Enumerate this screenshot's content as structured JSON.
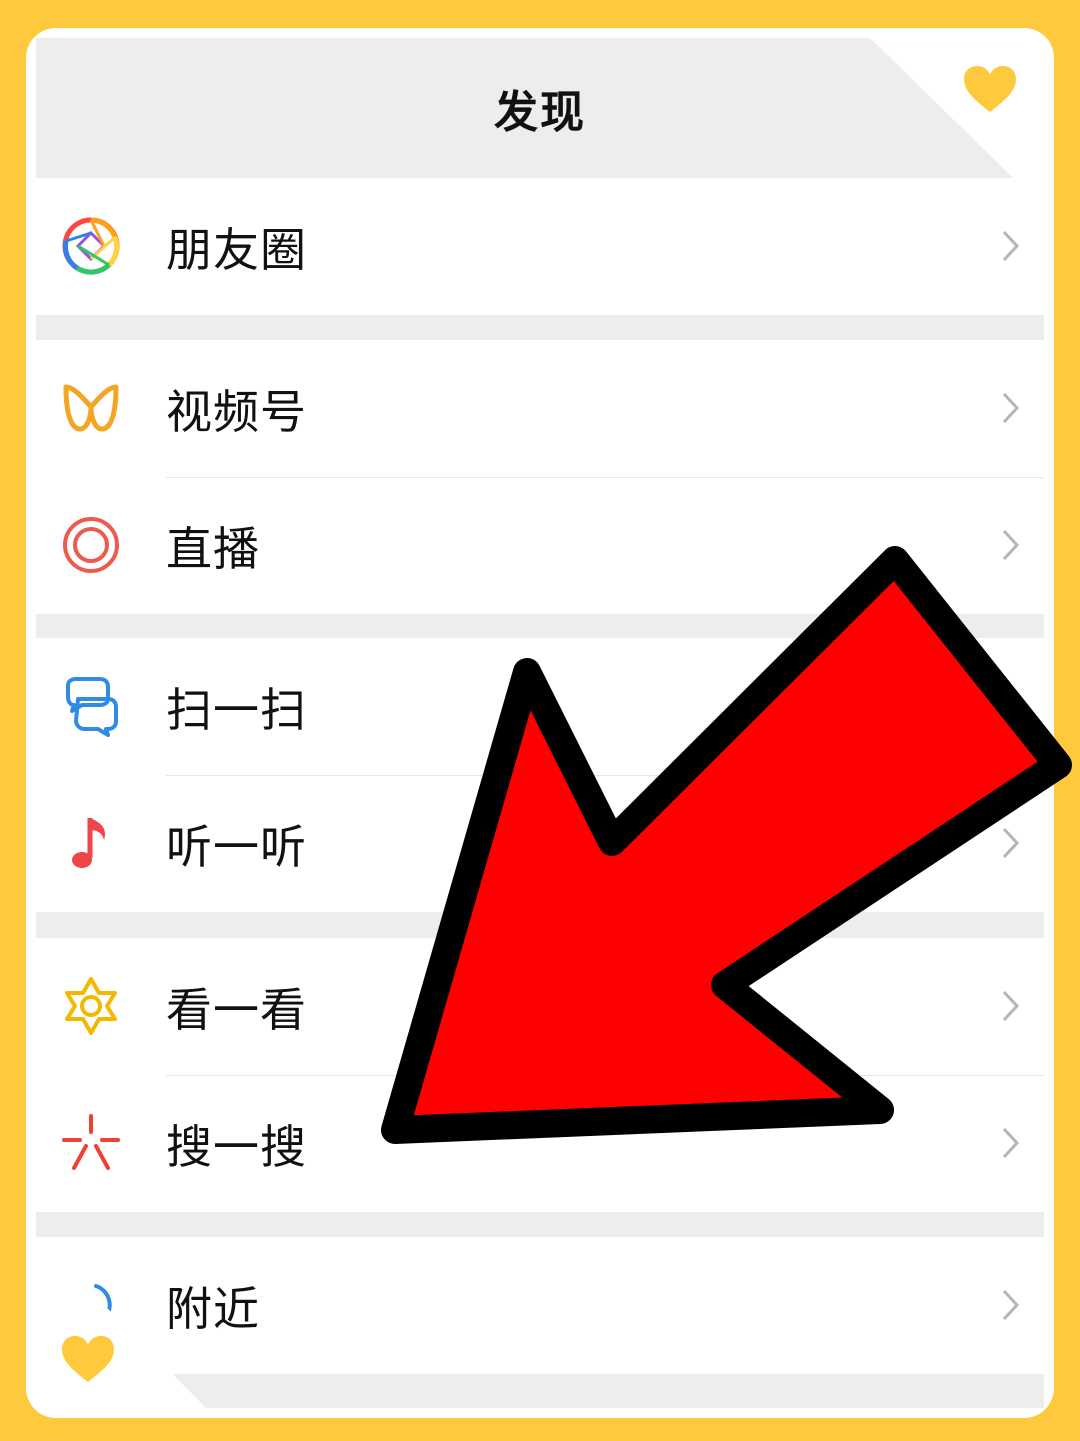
{
  "header": {
    "title": "发现"
  },
  "menu": [
    {
      "label": "朋友圈",
      "icon": "moments-aperture-icon"
    },
    {
      "label": "视频号",
      "icon": "channels-butterfly-icon"
    },
    {
      "label": "直播",
      "icon": "live-ring-icon"
    },
    {
      "label": "扫一扫",
      "icon": "scan-icon"
    },
    {
      "label": "听一听",
      "icon": "music-note-icon"
    },
    {
      "label": "看一看",
      "icon": "top-stories-star-icon"
    },
    {
      "label": "搜一搜",
      "icon": "search-sparkle-icon"
    },
    {
      "label": "附近",
      "icon": "nearby-signal-icon"
    }
  ],
  "colors": {
    "frame": "#FFC93D",
    "arrow_fill": "#FF0000",
    "arrow_outline": "#000000",
    "heart": "#FFC93D"
  }
}
